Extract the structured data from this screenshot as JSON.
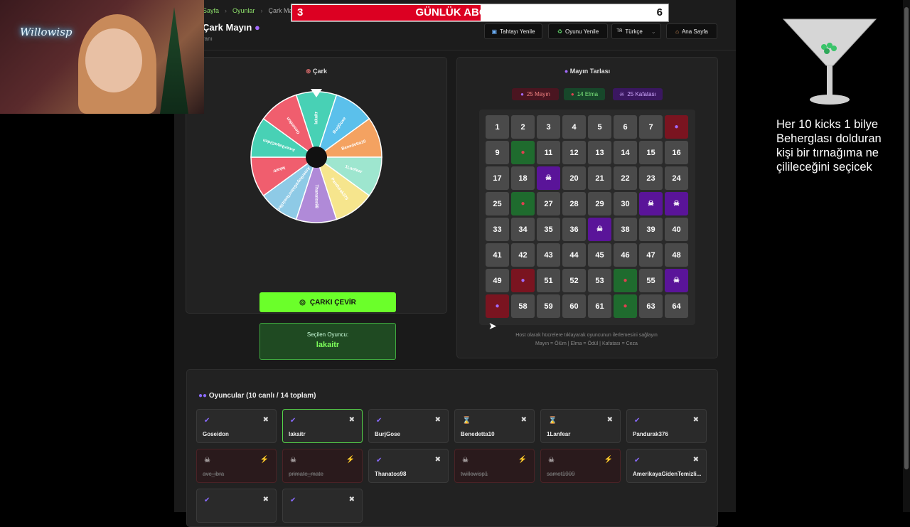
{
  "app": {
    "breadcrumb": [
      "Sayfa",
      "Oyunlar",
      "Çark Mayın"
    ],
    "title": "Çark Mayın",
    "subtitle": "ranı",
    "toolbar": {
      "refresh_board": "Tahtayı Yenile",
      "refresh_game": "Oyunu Yenile",
      "language": "Türkçe",
      "language_flag": "TR",
      "home": "Ana Sayfa"
    },
    "wheel_panel": {
      "title": "Çark",
      "segments": [
        "lakaitr",
        "BurjGose",
        "Benedetta10",
        "1Lanfear",
        "Pandurak376",
        "Thanatos98",
        "AmerikayaGidenTemizlikci",
        "lakaitr",
        "AmerikayaGiden",
        "Goseidon"
      ],
      "segment_colors": [
        "#48d1b5",
        "#5bc0eb",
        "#f4a261",
        "#9ee6cf",
        "#f6e58d",
        "#b08ad8",
        "#8ecae6",
        "#f05e6e",
        "#48d1b5",
        "#f05e6e"
      ],
      "spin_button": "ÇARKI ÇEVİR",
      "selected_label": "Seçilen Oyuncu:",
      "selected_name": "lakaitr"
    },
    "mine_panel": {
      "title": "Mayın Tarlası",
      "badges": {
        "mines": "25 Mayın",
        "apples": "14 Elma",
        "skulls": "25 Kafatası"
      },
      "cells": [
        "1",
        "2",
        "3",
        "4",
        "5",
        "6",
        "7",
        "mine",
        "9",
        "apple",
        "11",
        "12",
        "13",
        "14",
        "15",
        "16",
        "17",
        "18",
        "skull",
        "20",
        "21",
        "22",
        "23",
        "24",
        "25",
        "apple",
        "27",
        "28",
        "29",
        "30",
        "skull",
        "skull",
        "33",
        "34",
        "35",
        "36",
        "skull",
        "38",
        "39",
        "40",
        "41",
        "42",
        "43",
        "44",
        "45",
        "46",
        "47",
        "48",
        "49",
        "mine",
        "51",
        "52",
        "53",
        "apple",
        "55",
        "skull",
        "mine",
        "58",
        "59",
        "60",
        "61",
        "apple",
        "63",
        "64"
      ],
      "note": "Host olarak hücrelere tıklayarak oyuncunun ilerlemesini sağlayın",
      "legend": "Mayın = Ölüm | Elma = Ödül | Kafatası = Ceza"
    },
    "players_panel": {
      "title": "Oyuncular (10 canlı / 14 toplam)",
      "players": [
        {
          "name": "Goseidon",
          "status": "check",
          "state": "alive"
        },
        {
          "name": "lakaitr",
          "status": "check",
          "state": "active"
        },
        {
          "name": "BurjGose",
          "status": "check",
          "state": "alive"
        },
        {
          "name": "Benedetta10",
          "status": "hourglass",
          "state": "alive"
        },
        {
          "name": "1Lanfear",
          "status": "hourglass",
          "state": "alive"
        },
        {
          "name": "Pandurak376",
          "status": "check",
          "state": "alive"
        },
        {
          "name": "avc_ibra",
          "status": "skull",
          "state": "dead"
        },
        {
          "name": "primate_mate",
          "status": "skull",
          "state": "dead"
        },
        {
          "name": "Thanatos98",
          "status": "check",
          "state": "alive"
        },
        {
          "name": "twillowisp1",
          "status": "skull",
          "state": "dead"
        },
        {
          "name": "samet1909",
          "status": "skull",
          "state": "dead"
        },
        {
          "name": "AmerikayaGidenTemizli...",
          "status": "check",
          "state": "alive"
        },
        {
          "name": "",
          "status": "check",
          "state": "alive"
        },
        {
          "name": "",
          "status": "check",
          "state": "alive"
        }
      ]
    }
  },
  "overlay": {
    "webcam_sign": "Willowisp",
    "goal": {
      "current": "3",
      "title": "GÜNLÜK ABONE HEDEFI",
      "target": "6",
      "progress": 0.5
    },
    "side_text": "Her 10 kicks 1 bilye Beherglası dolduran kişi bir tırnağıma ne çilileceğini seçicek"
  },
  "colors": {
    "accent_green": "#6bff2a",
    "mine": "#7a1420",
    "apple": "#1f6b2e",
    "skull": "#5a1499",
    "goal_red": "#dc0022"
  }
}
